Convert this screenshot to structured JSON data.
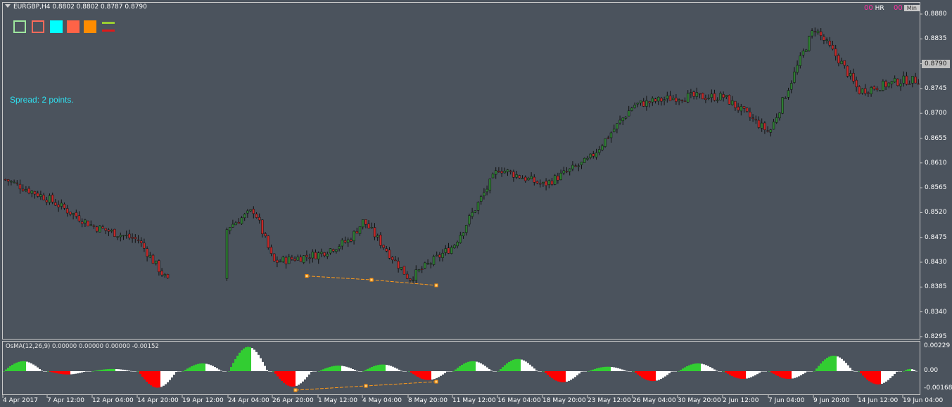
{
  "header": {
    "symbol_line": "EURGBP,H4  0.8802 0.8802 0.8787 0.8790"
  },
  "toolbar_swatches": [
    {
      "name": "outline-green-square",
      "color": "#9ee79e",
      "style": "outline"
    },
    {
      "name": "outline-red-square",
      "color": "#ff6a5a",
      "style": "outline"
    },
    {
      "name": "cyan-square",
      "color": "#00ffff",
      "style": "fill"
    },
    {
      "name": "tomato-square",
      "color": "#ff6347",
      "style": "fill"
    },
    {
      "name": "orange-square",
      "color": "#ff8c00",
      "style": "fill"
    },
    {
      "name": "line-pair-icon",
      "color": "#9acd32",
      "style": "lines"
    }
  ],
  "spread_text": "Spread: 2 points.",
  "top_right": {
    "hr_digits_1": "00",
    "hr_label": "HR",
    "hr_digits_2": "00",
    "min_label": "Min"
  },
  "price_axis": {
    "ticks": [
      "0.8880",
      "0.8835",
      "0.8790",
      "0.8745",
      "0.8700",
      "0.8655",
      "0.8610",
      "0.8565",
      "0.8520",
      "0.8475",
      "0.8430",
      "0.8385",
      "0.8340",
      "0.8295"
    ],
    "current_price": "0.8790"
  },
  "oscillator": {
    "title": "OsMA(12,26,9) 0.00000 0.00000 0.00000 -0.00152",
    "ticks": [
      "0.00229",
      "0.00",
      "-0.00168"
    ]
  },
  "time_axis": {
    "labels": [
      "4 Apr 2017",
      "7 Apr 12:00",
      "12 Apr 04:00",
      "14 Apr 20:00",
      "19 Apr 12:00",
      "24 Apr 04:00",
      "26 Apr 20:00",
      "1 May 12:00",
      "4 May 04:00",
      "8 May 20:00",
      "11 May 12:00",
      "16 May 04:00",
      "18 May 20:00",
      "23 May 12:00",
      "26 May 04:00",
      "30 May 20:00",
      "2 Jun 12:00",
      "7 Jun 04:00",
      "9 Jun 20:00",
      "14 Jun 12:00",
      "19 Jun 04:00"
    ]
  },
  "colors": {
    "background": "#4b535d",
    "bull_candle": "#2e7d32",
    "bear_candle": "#c62828",
    "wick": "#111111",
    "histogram_up": "#32cd32",
    "histogram_down": "#ff0000",
    "histogram_neutral": "#ffffff",
    "trendline": "#ff9a1a"
  },
  "chart_data": [
    {
      "type": "candlestick",
      "title": "EURGBP,H4",
      "ylim": [
        0.8295,
        0.888
      ],
      "x_range": [
        "4 Apr 2017",
        "19 Jun 04:00"
      ],
      "close_path": [
        {
          "x": "4 Apr 2017",
          "y": 0.858
        },
        {
          "x": "7 Apr 12:00",
          "y": 0.8545
        },
        {
          "x": "12 Apr 04:00",
          "y": 0.8495
        },
        {
          "x": "14 Apr 20:00",
          "y": 0.847
        },
        {
          "x": "17 Apr",
          "y": 0.8395
        },
        {
          "x": "19 Apr 12:00",
          "y": 0.8375
        },
        {
          "x": "24 Apr 04:00",
          "y": 0.8495
        },
        {
          "x": "25 Apr",
          "y": 0.8525
        },
        {
          "x": "26 Apr 20:00",
          "y": 0.843
        },
        {
          "x": "1 May 12:00",
          "y": 0.8445
        },
        {
          "x": "3 May",
          "y": 0.847
        },
        {
          "x": "4 May 04:00",
          "y": 0.8505
        },
        {
          "x": "8 May 20:00",
          "y": 0.84
        },
        {
          "x": "11 May 12:00",
          "y": 0.846
        },
        {
          "x": "16 May 04:00",
          "y": 0.86
        },
        {
          "x": "18 May 20:00",
          "y": 0.857
        },
        {
          "x": "23 May 12:00",
          "y": 0.8615
        },
        {
          "x": "26 May 04:00",
          "y": 0.8715
        },
        {
          "x": "30 May 20:00",
          "y": 0.873
        },
        {
          "x": "2 Jun 12:00",
          "y": 0.873
        },
        {
          "x": "7 Jun 04:00",
          "y": 0.8665
        },
        {
          "x": "8 Jun",
          "y": 0.881
        },
        {
          "x": "9 Jun 20:00",
          "y": 0.8855
        },
        {
          "x": "12 Jun",
          "y": 0.879
        },
        {
          "x": "14 Jun 12:00",
          "y": 0.874
        },
        {
          "x": "19 Jun 04:00",
          "y": 0.876
        }
      ],
      "trendline": {
        "color": "#ff9a1a",
        "points": [
          [
            0.8405,
            "27 Apr"
          ],
          [
            0.8398,
            "3 May"
          ],
          [
            0.8388,
            "8 May"
          ]
        ]
      }
    },
    {
      "type": "histogram",
      "title": "OsMA(12,26,9)",
      "ylim": [
        -0.00168,
        0.00229
      ],
      "segments": [
        {
          "x": "4 Apr 2017",
          "value": 0.0009,
          "sign": "up"
        },
        {
          "x": "7 Apr 12:00",
          "value": -0.0003,
          "sign": "down"
        },
        {
          "x": "12 Apr 04:00",
          "value": 0.0002,
          "sign": "up"
        },
        {
          "x": "14 Apr 20:00",
          "value": -0.0015,
          "sign": "down"
        },
        {
          "x": "19 Apr 12:00",
          "value": 0.0007,
          "sign": "up"
        },
        {
          "x": "24 Apr 04:00",
          "value": 0.0022,
          "sign": "up"
        },
        {
          "x": "26 Apr 20:00",
          "value": -0.0014,
          "sign": "down"
        },
        {
          "x": "1 May 12:00",
          "value": 0.0005,
          "sign": "up"
        },
        {
          "x": "4 May 04:00",
          "value": 0.0006,
          "sign": "up"
        },
        {
          "x": "8 May 20:00",
          "value": -0.0008,
          "sign": "down"
        },
        {
          "x": "11 May 12:00",
          "value": 0.0009,
          "sign": "up"
        },
        {
          "x": "16 May 04:00",
          "value": 0.0011,
          "sign": "up"
        },
        {
          "x": "18 May 20:00",
          "value": -0.001,
          "sign": "down"
        },
        {
          "x": "23 May 12:00",
          "value": 0.0004,
          "sign": "up"
        },
        {
          "x": "26 May 04:00",
          "value": -0.0009,
          "sign": "down"
        },
        {
          "x": "30 May 20:00",
          "value": 0.0007,
          "sign": "up"
        },
        {
          "x": "2 Jun 12:00",
          "value": -0.0007,
          "sign": "down"
        },
        {
          "x": "7 Jun 04:00",
          "value": -0.0007,
          "sign": "down"
        },
        {
          "x": "9 Jun 20:00",
          "value": 0.0014,
          "sign": "up"
        },
        {
          "x": "14 Jun 12:00",
          "value": -0.0012,
          "sign": "down"
        },
        {
          "x": "19 Jun 04:00",
          "value": 0.0002,
          "sign": "up"
        }
      ],
      "trendline": {
        "color": "#ff9a1a"
      }
    }
  ]
}
